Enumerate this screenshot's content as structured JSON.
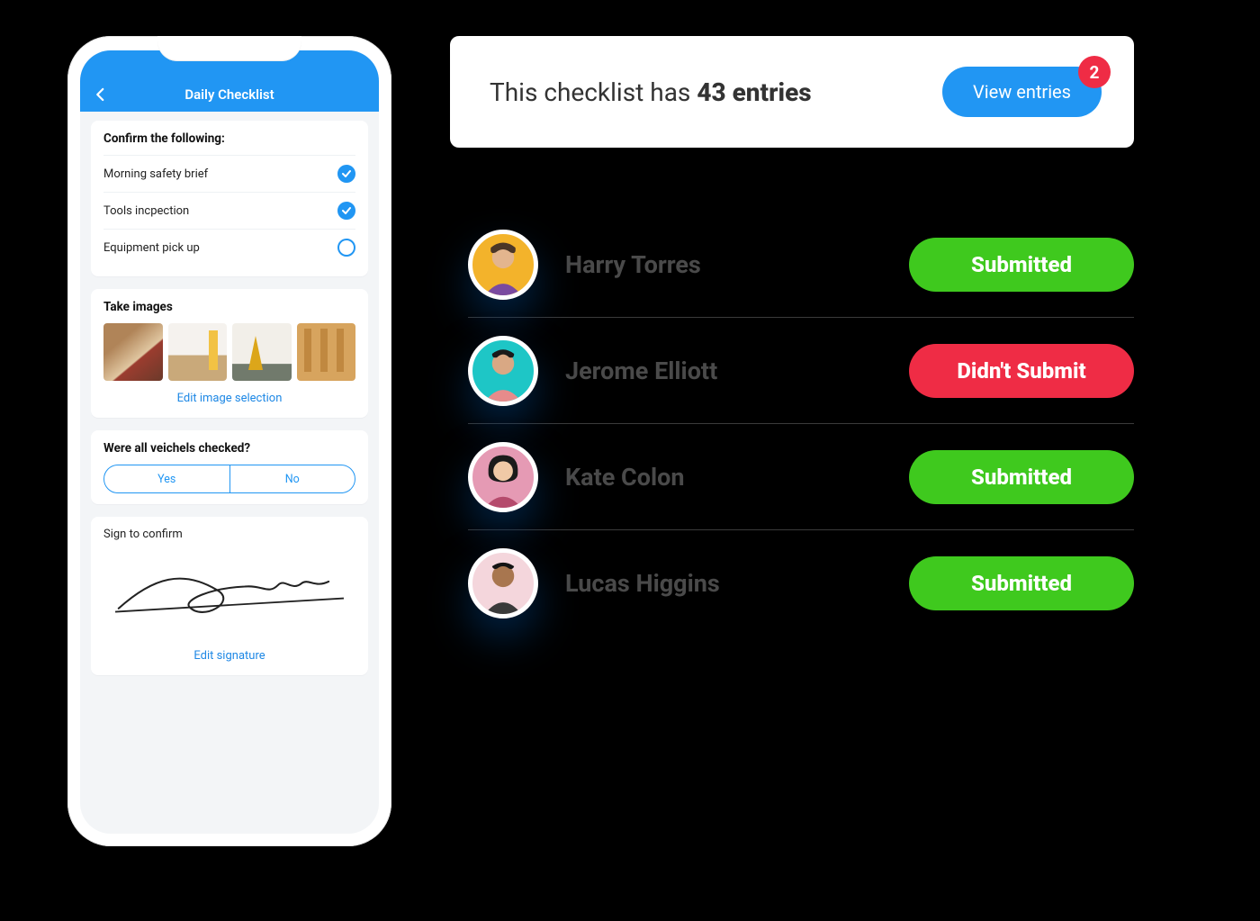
{
  "phone": {
    "header_title": "Daily Checklist",
    "confirm_header": "Confirm the following:",
    "items": [
      {
        "label": "Morning safety brief",
        "checked": true
      },
      {
        "label": "Tools incpection",
        "checked": true
      },
      {
        "label": "Equipment pick up",
        "checked": false
      }
    ],
    "images_header": "Take  images",
    "edit_images_label": "Edit image selection",
    "question_header": "Were all veichels checked?",
    "yes_label": "Yes",
    "no_label": "No",
    "signature_header": "Sign to confirm",
    "edit_signature_label": "Edit signature"
  },
  "summary": {
    "prefix": "This checklist has ",
    "count_label": "43 entries",
    "view_label": "View entries",
    "badge": "2"
  },
  "entries": [
    {
      "name": "Harry Torres",
      "status": "Submitted",
      "status_kind": "green",
      "avatar_bg": "#f3b32b",
      "avatar_shirt": "#7a4aa0"
    },
    {
      "name": "Jerome Elliott",
      "status": "Didn't Submit",
      "status_kind": "red",
      "avatar_bg": "#1ec6c6",
      "avatar_shirt": "#e78b8b"
    },
    {
      "name": "Kate Colon",
      "status": "Submitted",
      "status_kind": "green",
      "avatar_bg": "#e59ab4",
      "avatar_shirt": "#b54a6c"
    },
    {
      "name": "Lucas Higgins",
      "status": "Submitted",
      "status_kind": "green",
      "avatar_bg": "#f4d6dc",
      "avatar_shirt": "#3a3a3a"
    }
  ]
}
